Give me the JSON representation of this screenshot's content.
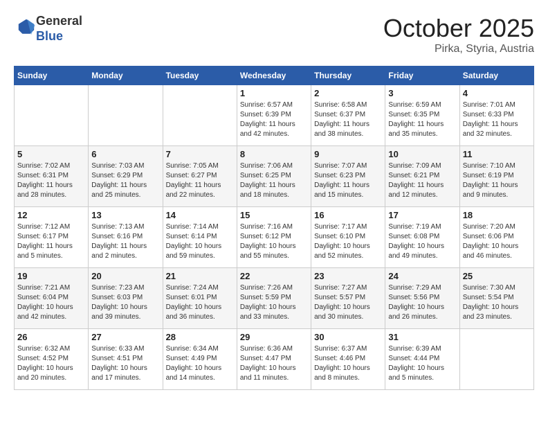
{
  "header": {
    "logo_general": "General",
    "logo_blue": "Blue",
    "month_title": "October 2025",
    "location": "Pirka, Styria, Austria"
  },
  "weekdays": [
    "Sunday",
    "Monday",
    "Tuesday",
    "Wednesday",
    "Thursday",
    "Friday",
    "Saturday"
  ],
  "weeks": [
    [
      null,
      null,
      null,
      {
        "day": "1",
        "sunrise": "6:57 AM",
        "sunset": "6:39 PM",
        "daylight": "11 hours and 42 minutes."
      },
      {
        "day": "2",
        "sunrise": "6:58 AM",
        "sunset": "6:37 PM",
        "daylight": "11 hours and 38 minutes."
      },
      {
        "day": "3",
        "sunrise": "6:59 AM",
        "sunset": "6:35 PM",
        "daylight": "11 hours and 35 minutes."
      },
      {
        "day": "4",
        "sunrise": "7:01 AM",
        "sunset": "6:33 PM",
        "daylight": "11 hours and 32 minutes."
      }
    ],
    [
      {
        "day": "5",
        "sunrise": "7:02 AM",
        "sunset": "6:31 PM",
        "daylight": "11 hours and 28 minutes."
      },
      {
        "day": "6",
        "sunrise": "7:03 AM",
        "sunset": "6:29 PM",
        "daylight": "11 hours and 25 minutes."
      },
      {
        "day": "7",
        "sunrise": "7:05 AM",
        "sunset": "6:27 PM",
        "daylight": "11 hours and 22 minutes."
      },
      {
        "day": "8",
        "sunrise": "7:06 AM",
        "sunset": "6:25 PM",
        "daylight": "11 hours and 18 minutes."
      },
      {
        "day": "9",
        "sunrise": "7:07 AM",
        "sunset": "6:23 PM",
        "daylight": "11 hours and 15 minutes."
      },
      {
        "day": "10",
        "sunrise": "7:09 AM",
        "sunset": "6:21 PM",
        "daylight": "11 hours and 12 minutes."
      },
      {
        "day": "11",
        "sunrise": "7:10 AM",
        "sunset": "6:19 PM",
        "daylight": "11 hours and 9 minutes."
      }
    ],
    [
      {
        "day": "12",
        "sunrise": "7:12 AM",
        "sunset": "6:17 PM",
        "daylight": "11 hours and 5 minutes."
      },
      {
        "day": "13",
        "sunrise": "7:13 AM",
        "sunset": "6:16 PM",
        "daylight": "11 hours and 2 minutes."
      },
      {
        "day": "14",
        "sunrise": "7:14 AM",
        "sunset": "6:14 PM",
        "daylight": "10 hours and 59 minutes."
      },
      {
        "day": "15",
        "sunrise": "7:16 AM",
        "sunset": "6:12 PM",
        "daylight": "10 hours and 55 minutes."
      },
      {
        "day": "16",
        "sunrise": "7:17 AM",
        "sunset": "6:10 PM",
        "daylight": "10 hours and 52 minutes."
      },
      {
        "day": "17",
        "sunrise": "7:19 AM",
        "sunset": "6:08 PM",
        "daylight": "10 hours and 49 minutes."
      },
      {
        "day": "18",
        "sunrise": "7:20 AM",
        "sunset": "6:06 PM",
        "daylight": "10 hours and 46 minutes."
      }
    ],
    [
      {
        "day": "19",
        "sunrise": "7:21 AM",
        "sunset": "6:04 PM",
        "daylight": "10 hours and 42 minutes."
      },
      {
        "day": "20",
        "sunrise": "7:23 AM",
        "sunset": "6:03 PM",
        "daylight": "10 hours and 39 minutes."
      },
      {
        "day": "21",
        "sunrise": "7:24 AM",
        "sunset": "6:01 PM",
        "daylight": "10 hours and 36 minutes."
      },
      {
        "day": "22",
        "sunrise": "7:26 AM",
        "sunset": "5:59 PM",
        "daylight": "10 hours and 33 minutes."
      },
      {
        "day": "23",
        "sunrise": "7:27 AM",
        "sunset": "5:57 PM",
        "daylight": "10 hours and 30 minutes."
      },
      {
        "day": "24",
        "sunrise": "7:29 AM",
        "sunset": "5:56 PM",
        "daylight": "10 hours and 26 minutes."
      },
      {
        "day": "25",
        "sunrise": "7:30 AM",
        "sunset": "5:54 PM",
        "daylight": "10 hours and 23 minutes."
      }
    ],
    [
      {
        "day": "26",
        "sunrise": "6:32 AM",
        "sunset": "4:52 PM",
        "daylight": "10 hours and 20 minutes."
      },
      {
        "day": "27",
        "sunrise": "6:33 AM",
        "sunset": "4:51 PM",
        "daylight": "10 hours and 17 minutes."
      },
      {
        "day": "28",
        "sunrise": "6:34 AM",
        "sunset": "4:49 PM",
        "daylight": "10 hours and 14 minutes."
      },
      {
        "day": "29",
        "sunrise": "6:36 AM",
        "sunset": "4:47 PM",
        "daylight": "10 hours and 11 minutes."
      },
      {
        "day": "30",
        "sunrise": "6:37 AM",
        "sunset": "4:46 PM",
        "daylight": "10 hours and 8 minutes."
      },
      {
        "day": "31",
        "sunrise": "6:39 AM",
        "sunset": "4:44 PM",
        "daylight": "10 hours and 5 minutes."
      },
      null
    ]
  ]
}
